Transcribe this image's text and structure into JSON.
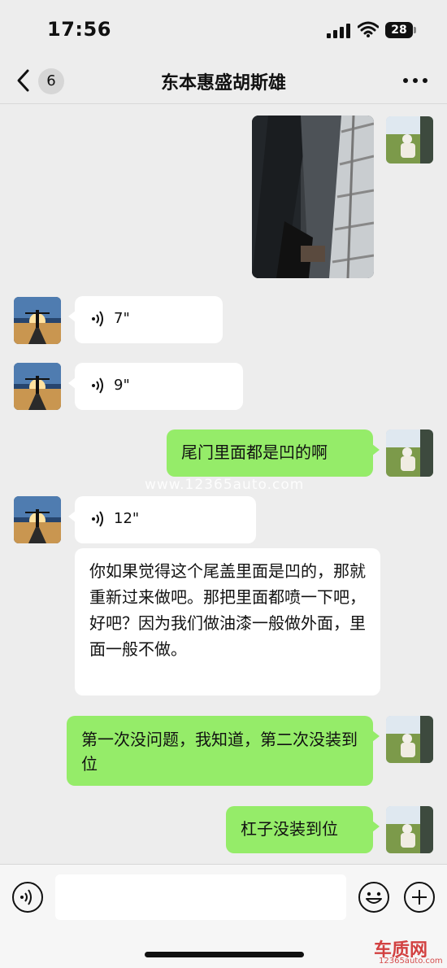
{
  "status_bar": {
    "time": "17:56",
    "battery": "28"
  },
  "nav": {
    "back_count": "6",
    "title": "东本惠盛胡斯雄"
  },
  "messages": {
    "voice1": {
      "duration": "7\""
    },
    "voice2": {
      "duration": "9\""
    },
    "sent1": {
      "text": "尾门里面都是凹的啊"
    },
    "voice3": {
      "duration": "12\""
    },
    "recv_text": {
      "text": "你如果觉得这个尾盖里面是凹的，那就重新过来做吧。那把里面都喷一下吧，好吧？因为我们做油漆一般做外面，里面一般不做。"
    },
    "sent2": {
      "text": "第一次没问题，我知道，第二次没装到位"
    },
    "sent3": {
      "text": "杠子没装到位"
    }
  },
  "watermark": "www.12365auto.com",
  "logo": {
    "name": "车质网",
    "url": "12365auto.com"
  },
  "colors": {
    "background": "#ededed",
    "sent_bubble": "#95ec69",
    "received_bubble": "#ffffff"
  }
}
